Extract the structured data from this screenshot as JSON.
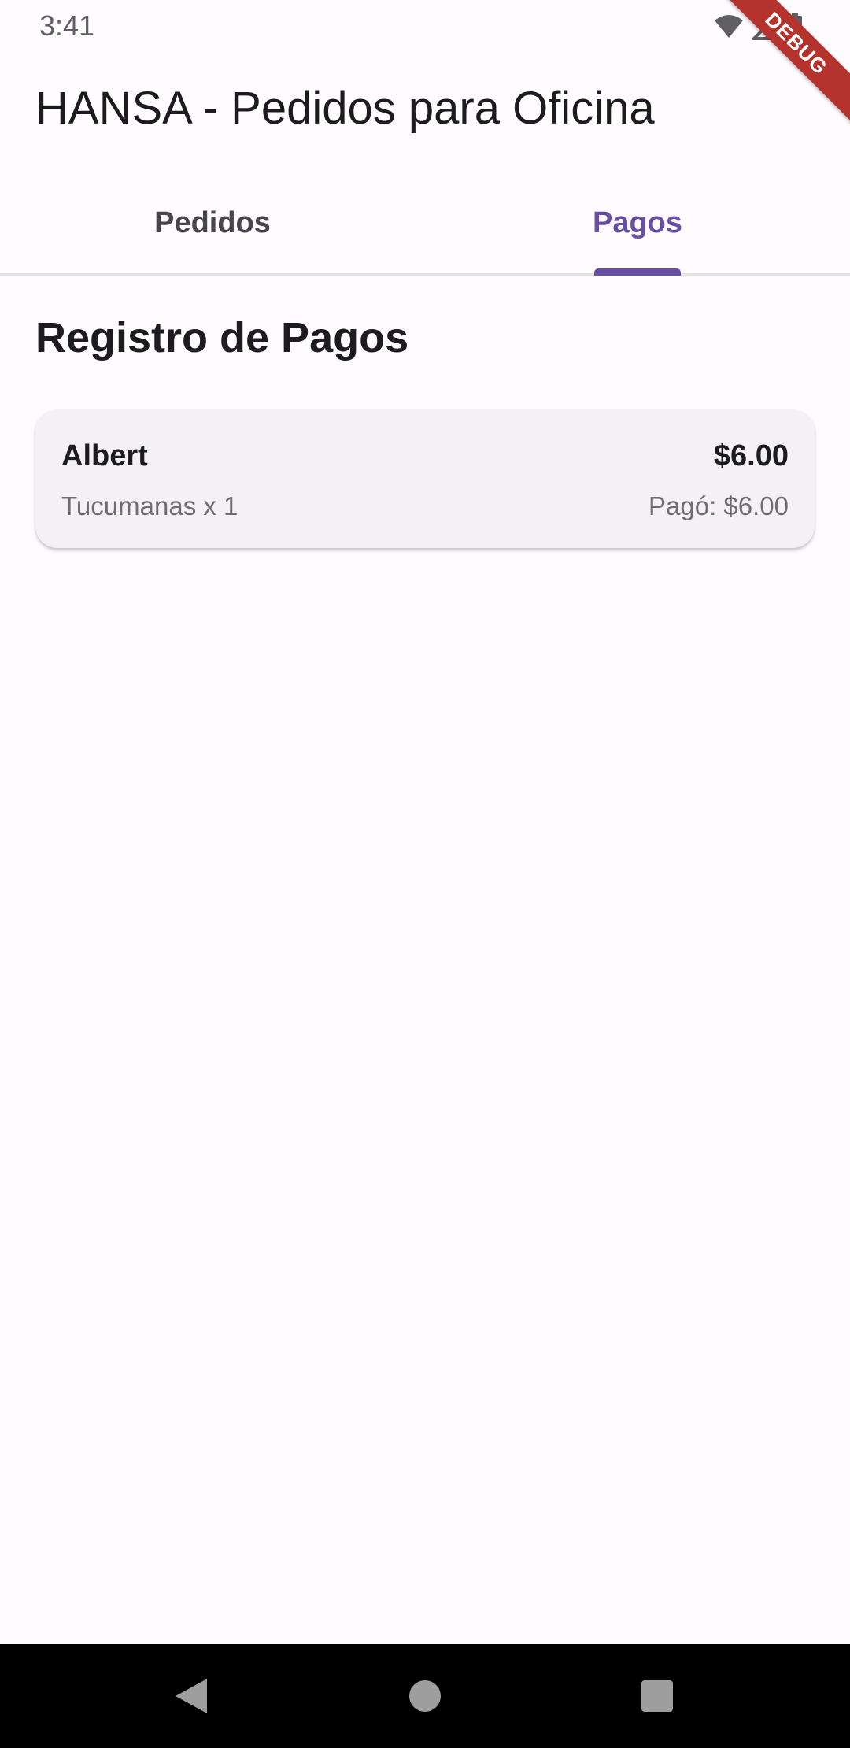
{
  "status_bar": {
    "time": "3:41",
    "icons": [
      "wifi-icon",
      "signal-icon",
      "battery-icon"
    ]
  },
  "debug_banner": {
    "label": "DEBUG",
    "color": "#b5332d"
  },
  "app_bar": {
    "title": "HANSA - Pedidos para Oficina"
  },
  "tabs": [
    {
      "label": "Pedidos",
      "active": false
    },
    {
      "label": "Pagos",
      "active": true
    }
  ],
  "main": {
    "section_title": "Registro de Pagos",
    "payments": [
      {
        "name": "Albert",
        "total": "$6.00",
        "detail": "Tucumanas x 1",
        "paid": "Pagó: $6.00"
      }
    ]
  },
  "nav_bar": {
    "buttons": [
      "back-icon",
      "home-icon",
      "recents-icon"
    ]
  },
  "colors": {
    "accent": "#6750a4",
    "background": "#fffbfe",
    "card": "#f4f1f6"
  }
}
